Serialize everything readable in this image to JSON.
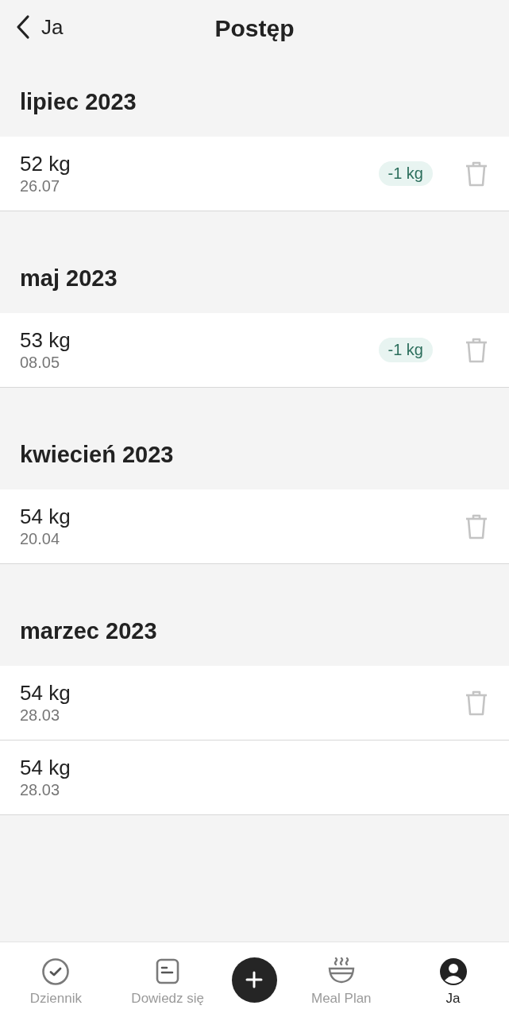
{
  "header": {
    "back_label": "Ja",
    "title": "Postęp"
  },
  "months": [
    {
      "title": "lipiec 2023",
      "entries": [
        {
          "weight": "52 kg",
          "date": "26.07",
          "change": "-1 kg",
          "deletable": true
        }
      ]
    },
    {
      "title": "maj 2023",
      "entries": [
        {
          "weight": "53 kg",
          "date": "08.05",
          "change": "-1 kg",
          "deletable": true
        }
      ]
    },
    {
      "title": "kwiecień 2023",
      "entries": [
        {
          "weight": "54 kg",
          "date": "20.04",
          "deletable": true
        }
      ]
    },
    {
      "title": "marzec 2023",
      "entries": [
        {
          "weight": "54 kg",
          "date": "28.03",
          "deletable": true
        },
        {
          "weight": "54 kg",
          "date": "28.03",
          "deletable": false
        }
      ]
    }
  ],
  "tabs": [
    {
      "kind": "diary",
      "label": "Dziennik",
      "selected": false
    },
    {
      "kind": "learn",
      "label": "Dowiedz się",
      "selected": false
    },
    {
      "kind": "add"
    },
    {
      "kind": "meal",
      "label": "Meal Plan",
      "selected": false
    },
    {
      "kind": "profile",
      "label": "Ja",
      "selected": true
    }
  ]
}
